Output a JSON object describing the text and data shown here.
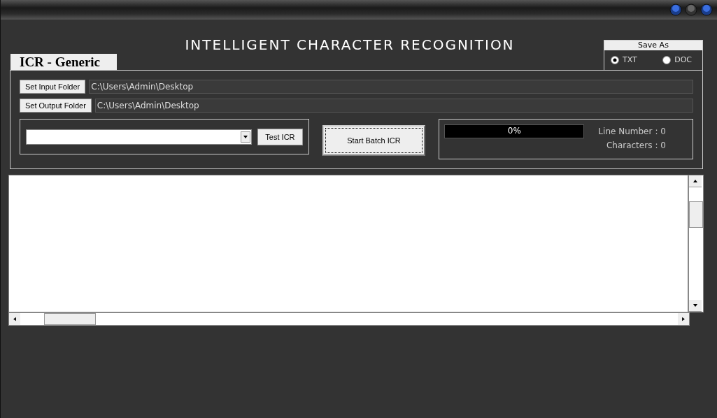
{
  "window": {
    "title": "INTELLIGENT CHARACTER RECOGNITION"
  },
  "tab": {
    "label": "ICR - Generic",
    "selected": true
  },
  "save_as": {
    "title": "Save As",
    "options": [
      {
        "label": "TXT",
        "selected": true
      },
      {
        "label": "DOC",
        "selected": false
      }
    ]
  },
  "folders": [
    {
      "button": "Set Input Folder",
      "value": "C:\\Users\\Admin\\Desktop"
    },
    {
      "button": "Set Output Folder",
      "value": "C:\\Users\\Admin\\Desktop"
    }
  ],
  "test_button": "Test ICR",
  "start_button": "Start Batch ICR",
  "progress": {
    "level": 0,
    "reading": "0%"
  },
  "stats": [
    {
      "label": "Line Number",
      "value": ": 0"
    },
    {
      "label": "Characters",
      "value": ": 0"
    }
  ]
}
